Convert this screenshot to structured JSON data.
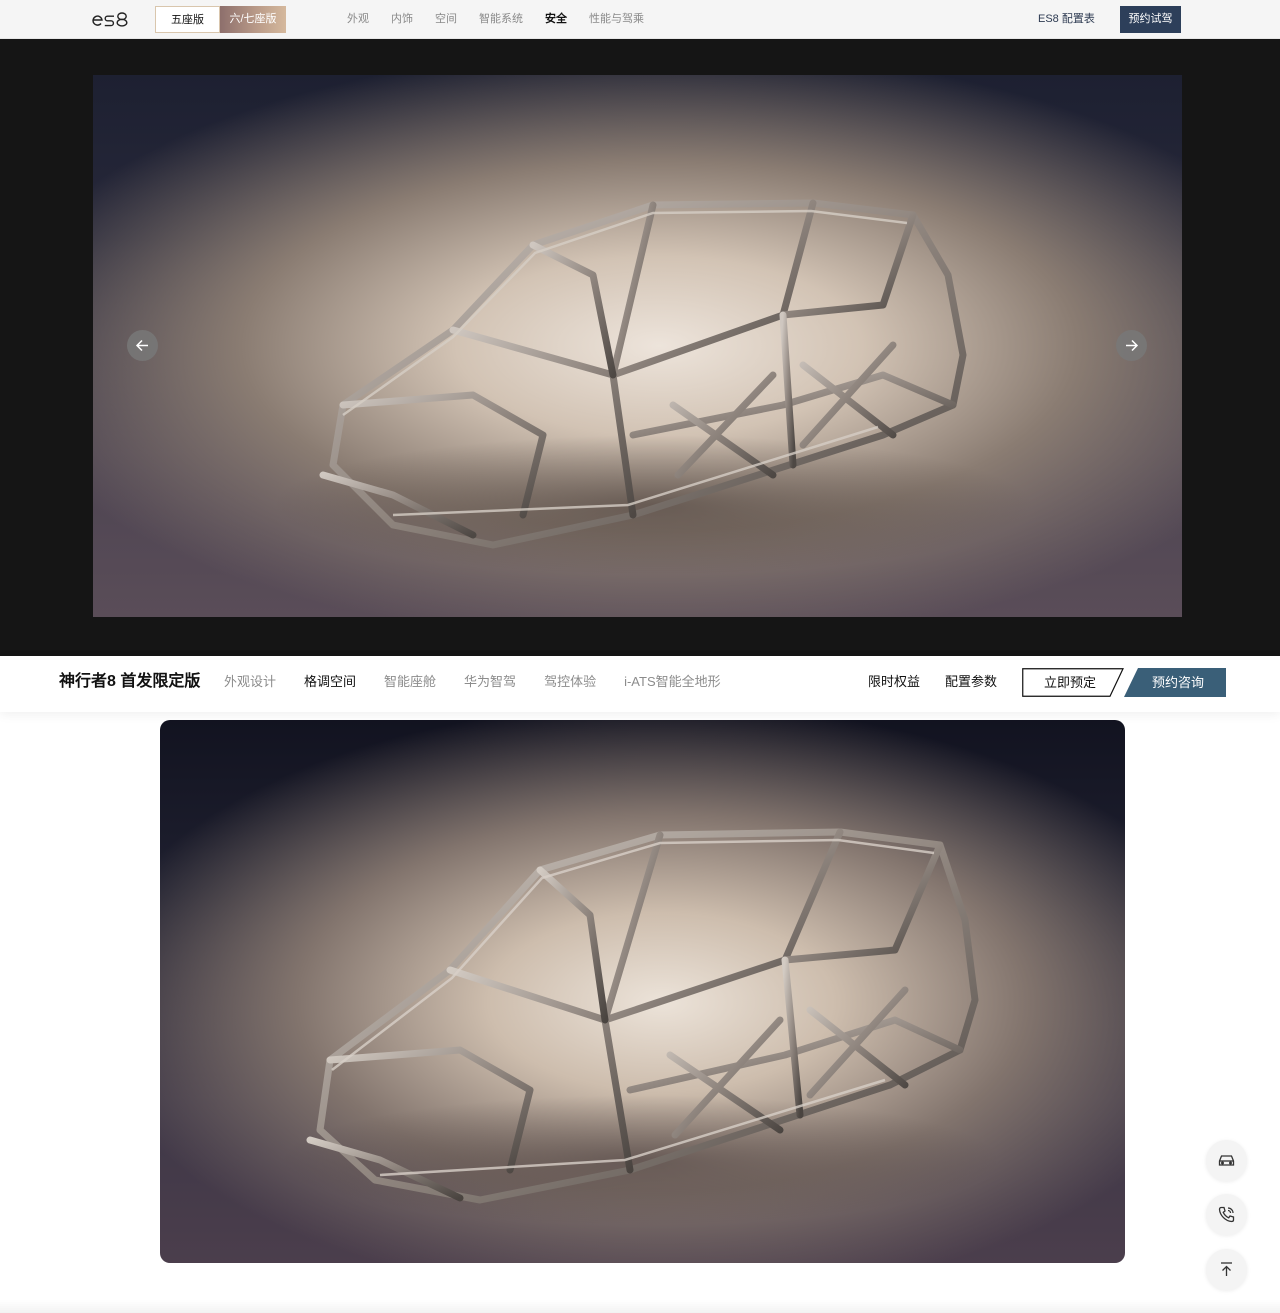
{
  "topnav": {
    "logo_text": "es8",
    "seat_options": [
      "五座版",
      "六/七座版"
    ],
    "links": [
      "外观",
      "内饰",
      "空间",
      "智能系统",
      "安全",
      "性能与驾乘"
    ],
    "spec_link": "ES8 配置表",
    "test_drive": "预约试驾"
  },
  "hero": {
    "image_icon": "car-body-frame-image",
    "prev_icon": "arrow-left-icon",
    "next_icon": "arrow-right-icon"
  },
  "subnav": {
    "model_name": "神行者8 首发限定版",
    "links": [
      "外观设计",
      "格调空间",
      "智能座舱",
      "华为智驾",
      "驾控体验",
      "i-ATS智能全地形"
    ],
    "benefits": "限时权益",
    "params": "配置参数",
    "order": "立即预定",
    "consult": "预约咨询"
  },
  "content": {
    "image_icon": "car-body-frame-image"
  },
  "floating": {
    "icons": [
      "car-icon",
      "phone-icon",
      "back-to-top-icon"
    ]
  },
  "colors": {
    "nav_bg": "#f5f5f5",
    "hero_bg": "#151515",
    "test_drive_bg": "#2d3f5a",
    "consult_bg": "#3a5f78",
    "active_text": "#111111",
    "muted_text": "#8c8c8c"
  }
}
